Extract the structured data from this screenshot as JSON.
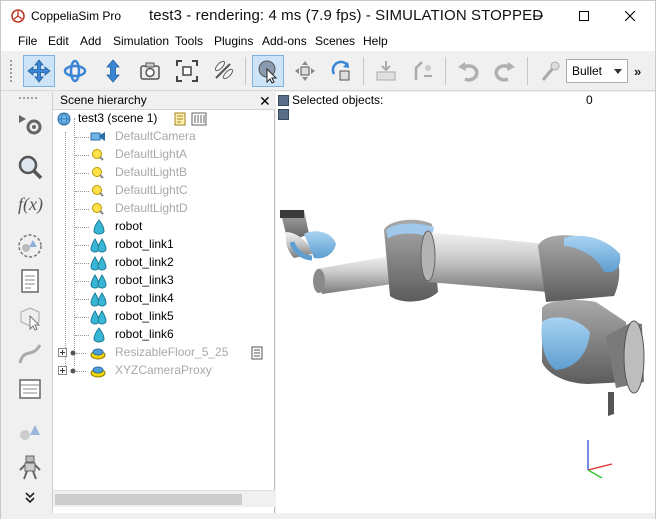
{
  "window": {
    "app_name": "CoppeliaSim Pro",
    "title": "test3 - rendering: 4 ms (7.9 fps) - SIMULATION STOPPED"
  },
  "menu": [
    "File",
    "Edit",
    "Add",
    "Simulation",
    "Tools",
    "Plugins",
    "Add-ons",
    "Scenes",
    "Help"
  ],
  "toolbar": {
    "engine_selected": "Bullet",
    "more": "»"
  },
  "hierarchy": {
    "title": "Scene hierarchy",
    "close": "✕",
    "items": [
      {
        "label": "test3 (scene 1)",
        "icon": "scene-globe-icon"
      },
      {
        "label": "DefaultCamera",
        "icon": "camera-icon"
      },
      {
        "label": "DefaultLightA",
        "icon": "light-bulb-icon"
      },
      {
        "label": "DefaultLightB",
        "icon": "light-bulb-icon"
      },
      {
        "label": "DefaultLightC",
        "icon": "light-bulb-icon"
      },
      {
        "label": "DefaultLightD",
        "icon": "light-bulb-icon"
      },
      {
        "label": "robot",
        "icon": "shape-icon"
      },
      {
        "label": "robot_link1",
        "icon": "compound-shape-icon"
      },
      {
        "label": "robot_link2",
        "icon": "compound-shape-icon"
      },
      {
        "label": "robot_link3",
        "icon": "compound-shape-icon"
      },
      {
        "label": "robot_link4",
        "icon": "compound-shape-icon"
      },
      {
        "label": "robot_link5",
        "icon": "compound-shape-icon"
      },
      {
        "label": "robot_link6",
        "icon": "shape-icon"
      },
      {
        "label": "ResizableFloor_5_25",
        "icon": "model-icon"
      },
      {
        "label": "XYZCameraProxy",
        "icon": "model-icon"
      }
    ]
  },
  "viewport": {
    "selected_label": "Selected objects:",
    "selected_count": "0"
  },
  "colors": {
    "accent": "#7fb2e0",
    "robot_gray": "#a8a8a8",
    "robot_blue": "#7fb6e0"
  }
}
